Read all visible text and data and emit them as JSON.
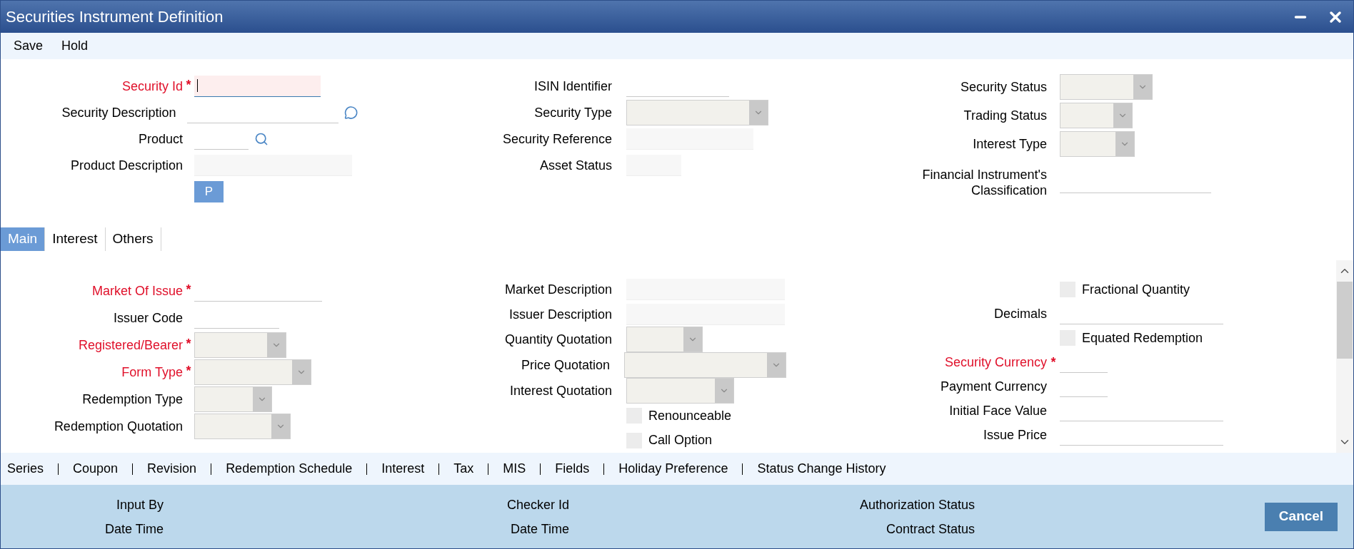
{
  "window": {
    "title": "Securities Instrument Definition"
  },
  "toolbar": [
    "Save",
    "Hold"
  ],
  "header": {
    "columns": [
      [
        {
          "label": "Security Id",
          "mark": "*",
          "required": true,
          "kind": "text",
          "focused": true
        },
        {
          "label": "Security Description",
          "required": false,
          "kind": "text",
          "focused": false
        },
        {
          "label": "Product",
          "required": false,
          "kind": "text",
          "focused": false
        },
        {
          "label": "Product Description",
          "required": false,
          "kind": "readonly",
          "focused": false
        }
      ],
      [
        {
          "label": "ISIN Identifier",
          "required": false,
          "kind": "text",
          "focused": false
        },
        {
          "label": "Security Type",
          "required": false,
          "kind": "select",
          "focused": false
        },
        {
          "label": "Security Reference",
          "required": false,
          "kind": "readonly",
          "focused": false
        },
        {
          "label": "Asset Status",
          "required": false,
          "kind": "readonly",
          "focused": false
        }
      ],
      [
        {
          "label": "Security Status",
          "required": false,
          "kind": "select",
          "focused": false
        },
        {
          "label": "Trading Status",
          "required": false,
          "kind": "select",
          "focused": false
        },
        {
          "label": "Interest Type",
          "required": false,
          "kind": "select",
          "focused": false
        },
        {
          "label": "Financial Instrument's Classification",
          "required": false,
          "kind": "text",
          "focused": false
        }
      ]
    ],
    "p_button": "P"
  },
  "tabs": [
    {
      "label": "Main",
      "selected": true
    },
    {
      "label": "Interest",
      "selected": false
    },
    {
      "label": "Others",
      "selected": false
    }
  ],
  "main": {
    "columns": [
      [
        {
          "label": "Market Of Issue",
          "mark": "*",
          "required": true,
          "kind": "text",
          "focused": false
        },
        {
          "label": "Issuer Code",
          "required": false,
          "kind": "text",
          "focused": false
        },
        {
          "label": "Registered/Bearer",
          "mark": "*",
          "required": true,
          "kind": "select",
          "focused": false
        },
        {
          "label": "Form Type",
          "mark": "*",
          "required": true,
          "kind": "select",
          "focused": false
        },
        {
          "label": "Redemption Type",
          "required": false,
          "kind": "select",
          "focused": false
        },
        {
          "label": "Redemption Quotation",
          "required": false,
          "kind": "select",
          "focused": false
        }
      ],
      [
        {
          "label": "Market Description",
          "required": false,
          "kind": "readonly",
          "focused": false
        },
        {
          "label": "Issuer Description",
          "required": false,
          "kind": "readonly",
          "focused": false
        },
        {
          "label": "Quantity Quotation",
          "required": false,
          "kind": "select",
          "focused": false
        },
        {
          "label": "Price Quotation",
          "required": false,
          "kind": "select",
          "focused": false
        },
        {
          "label": "Interest Quotation",
          "required": false,
          "kind": "select",
          "focused": false
        },
        {
          "label": "Renounceable",
          "required": false,
          "kind": "checkbox",
          "checked": false
        },
        {
          "label": "Call Option",
          "required": false,
          "kind": "checkbox",
          "checked": false
        }
      ],
      [
        {
          "label": "Fractional Quantity",
          "required": false,
          "kind": "checkbox",
          "checked": false
        },
        {
          "label": "Decimals",
          "required": false,
          "kind": "text",
          "focused": false
        },
        {
          "label": "Equated Redemption",
          "required": false,
          "kind": "checkbox",
          "checked": false
        },
        {
          "label": "Security Currency",
          "mark": "*",
          "required": true,
          "kind": "text",
          "focused": false
        },
        {
          "label": "Payment Currency",
          "required": false,
          "kind": "text",
          "focused": false
        },
        {
          "label": "Initial Face Value",
          "required": false,
          "kind": "text",
          "focused": false
        },
        {
          "label": "Issue Price",
          "required": false,
          "kind": "text",
          "focused": false
        }
      ]
    ]
  },
  "links": [
    "Series",
    "Coupon",
    "Revision",
    "Redemption Schedule",
    "Interest",
    "Tax",
    "MIS",
    "Fields",
    "Holiday Preference",
    "Status Change History"
  ],
  "footer": {
    "columns": [
      [
        "Input By",
        "Date Time"
      ],
      [
        "Checker Id",
        "Date Time"
      ],
      [
        "Authorization Status",
        "Contract Status"
      ]
    ],
    "cancel": "Cancel"
  }
}
